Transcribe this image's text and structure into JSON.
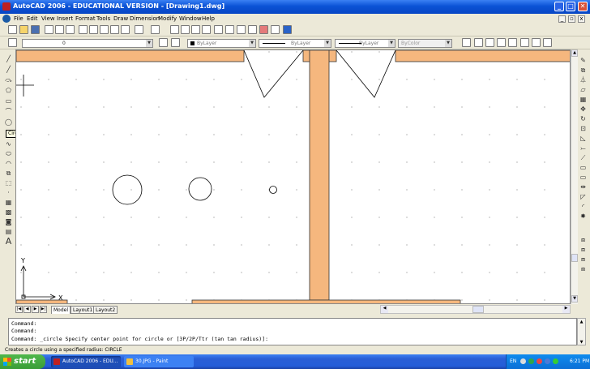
{
  "window": {
    "title": "AutoCAD 2006 - EDUCATIONAL VERSION - [Drawing1.dwg]",
    "minimize": "_",
    "maximize": "□",
    "close": "✕"
  },
  "menu": {
    "items": [
      "File",
      "Edit",
      "View",
      "Insert",
      "Format",
      "Tools",
      "Draw",
      "Dimension",
      "Modify",
      "Window",
      "Help"
    ]
  },
  "toolbar": {
    "layer_value": "0",
    "color_value": "ByLayer",
    "linetype_value": "ByLayer",
    "lineweight_value": "ByLayer",
    "plotstyle_value": "ByColor"
  },
  "tooltip": {
    "text": "Circle"
  },
  "drawing": {
    "ucs_y": "Y",
    "ucs_x": "X"
  },
  "tabs": [
    "Model",
    "Layout1",
    "Layout2"
  ],
  "command": {
    "line1": "Command:",
    "line2": "Command:",
    "line3": "Command: _circle Specify center point for circle or [3P/2P/Ttr (tan tan radius)]:"
  },
  "status": {
    "text": "Creates a circle using a specified radius:  CIRCLE"
  },
  "taskbar": {
    "start_label": "start",
    "tasks": [
      "AutoCAD 2006 - EDU...",
      "30.JPG - Paint"
    ],
    "tray_lang": "EN",
    "clock": "6:21 PM"
  },
  "colors": {
    "wall": "#f5b77e",
    "taskbar": "#245dd8",
    "titlebar": "#0a52d6"
  }
}
